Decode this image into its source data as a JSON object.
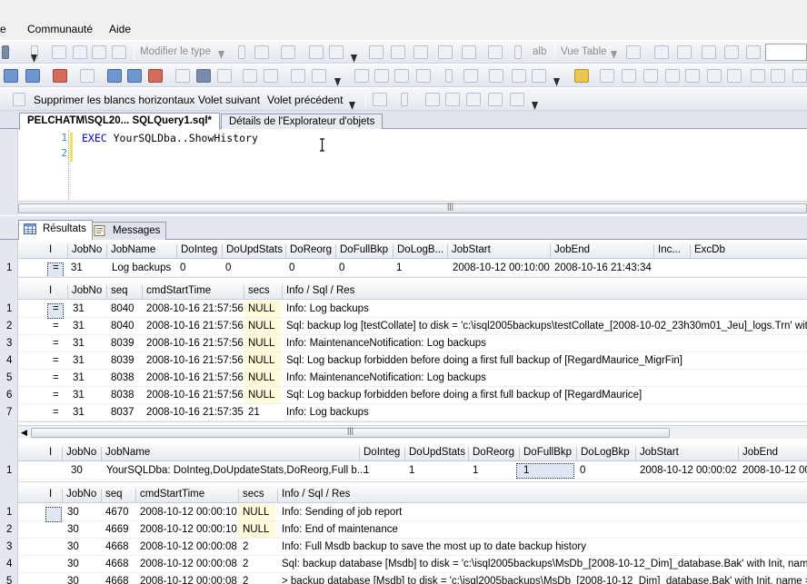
{
  "menu": {
    "items": [
      "e",
      "Communauté",
      "Aide"
    ]
  },
  "toolbar1": {
    "modify_type_label": "Modifier le type",
    "view_table_label": "Vue Table"
  },
  "toolbar3": {
    "remove_hspace_label": "Supprimer les blancs horizontaux",
    "next_pane_label": "Volet suivant",
    "prev_pane_label": "Volet précédent"
  },
  "tabs": {
    "query_tab": "PELCHATM\\SQL20... SQLQuery1.sql*",
    "explorer_tab": "Détails de l'Explorateur d'objets"
  },
  "editor": {
    "line_numbers": [
      "1",
      "2"
    ],
    "keyword": "EXEC",
    "statement": " YourSQLDba..ShowHistory"
  },
  "result_tabs": {
    "results": "Résultats",
    "messages": "Messages"
  },
  "grid1": {
    "columns": [
      "I",
      "JobNo",
      "JobName",
      "DoInteg",
      "DoUpdStats",
      "DoReorg",
      "DoFullBkp",
      "DoLogB...",
      "JobStart",
      "JobEnd",
      "Inc...",
      "ExcDb"
    ],
    "rows": [
      {
        "n": "1",
        "I": "=",
        "JobNo": "31",
        "JobName": "Log backups",
        "DoInteg": "0",
        "DoUpdStats": "0",
        "DoReorg": "0",
        "DoFullBkp": "0",
        "DoLogB": "1",
        "JobStart": "2008-10-12 00:10:00",
        "JobEnd": "2008-10-16 21:43:34"
      }
    ]
  },
  "grid2": {
    "columns": [
      "I",
      "JobNo",
      "seq",
      "cmdStartTime",
      "secs",
      "Info / Sql / Res"
    ],
    "rows": [
      {
        "n": "1",
        "I": "=",
        "JobNo": "31",
        "seq": "8040",
        "time": "2008-10-16 21:57:56",
        "secs": "NULL",
        "info": "Info: Log backups"
      },
      {
        "n": "2",
        "I": "=",
        "JobNo": "31",
        "seq": "8040",
        "time": "2008-10-16 21:57:56",
        "secs": "NULL",
        "info": "Sql:  backup log [testCollate] to disk = 'c:\\isql2005backups\\testCollate_[2008-10-02_23h30m01_Jeu]_logs.Trn' with noInit"
      },
      {
        "n": "3",
        "I": "=",
        "JobNo": "31",
        "seq": "8039",
        "time": "2008-10-16 21:57:56",
        "secs": "NULL",
        "info": "Info: MaintenanceNotification: Log backups"
      },
      {
        "n": "4",
        "I": "=",
        "JobNo": "31",
        "seq": "8039",
        "time": "2008-10-16 21:57:56",
        "secs": "NULL",
        "info": "Sql:  Log backup forbidden before doing a first full backup of [RegardMaurice_MigrFin]"
      },
      {
        "n": "5",
        "I": "=",
        "JobNo": "31",
        "seq": "8038",
        "time": "2008-10-16 21:57:56",
        "secs": "NULL",
        "info": "Info: MaintenanceNotification: Log backups"
      },
      {
        "n": "6",
        "I": "=",
        "JobNo": "31",
        "seq": "8038",
        "time": "2008-10-16 21:57:56",
        "secs": "NULL",
        "info": "Sql:  Log backup forbidden before doing a first full backup of [RegardMaurice]"
      },
      {
        "n": "7",
        "I": "=",
        "JobNo": "31",
        "seq": "8037",
        "time": "2008-10-16 21:57:35",
        "secs": "21",
        "info": "Info: Log backups"
      }
    ]
  },
  "grid3": {
    "columns": [
      "I",
      "JobNo",
      "JobName",
      "DoInteg",
      "DoUpdStats",
      "DoReorg",
      "DoFullBkp",
      "DoLogBkp",
      "JobStart",
      "JobEnd"
    ],
    "rows": [
      {
        "n": "1",
        "I": "",
        "JobNo": "30",
        "JobName": "YourSQLDba: DoInteg,DoUpdateStats,DoReorg,Full b...",
        "DoInteg": "1",
        "DoUpdStats": "1",
        "DoReorg": "1",
        "DoFullBkp": "1",
        "DoLogBkp": "0",
        "JobStart": "2008-10-12 00:00:02",
        "JobEnd": "2008-10-12 00"
      }
    ]
  },
  "grid4": {
    "columns": [
      "I",
      "JobNo",
      "seq",
      "cmdStartTime",
      "secs",
      "Info / Sql / Res"
    ],
    "rows": [
      {
        "n": "1",
        "I": "",
        "JobNo": "30",
        "seq": "4670",
        "time": "2008-10-12 00:00:10",
        "secs": "NULL",
        "info": "Info: Sending of job report"
      },
      {
        "n": "2",
        "I": "",
        "JobNo": "30",
        "seq": "4669",
        "time": "2008-10-12 00:00:10",
        "secs": "NULL",
        "info": "Info: End of maintenance"
      },
      {
        "n": "3",
        "I": "",
        "JobNo": "30",
        "seq": "4668",
        "time": "2008-10-12 00:00:08",
        "secs": "2",
        "info": "Info: Full Msdb backup to save the most up to date backup history"
      },
      {
        "n": "4",
        "I": "",
        "JobNo": "30",
        "seq": "4668",
        "time": "2008-10-12 00:00:08",
        "secs": "2",
        "info": "Sql:  backup database [Msdb] to disk = 'c:\\isql2005backups\\MsDb_[2008-10-12_Dim]_database.Bak' with Init, name = 'Yo"
      },
      {
        "n": "5",
        "I": "",
        "JobNo": "30",
        "seq": "4668",
        "time": "2008-10-12 00:00:08",
        "secs": "2",
        "info": "> backup database [Msdb] to disk = 'c:\\isql2005backups\\MsDb_[2008-10-12_Dim]_database.Bak' with Init, name = 'YourS"
      }
    ]
  },
  "colors": {
    "null_cell": "#fffbd8",
    "keyword": "#0000ff",
    "toolbar": "#e3e7ee"
  }
}
